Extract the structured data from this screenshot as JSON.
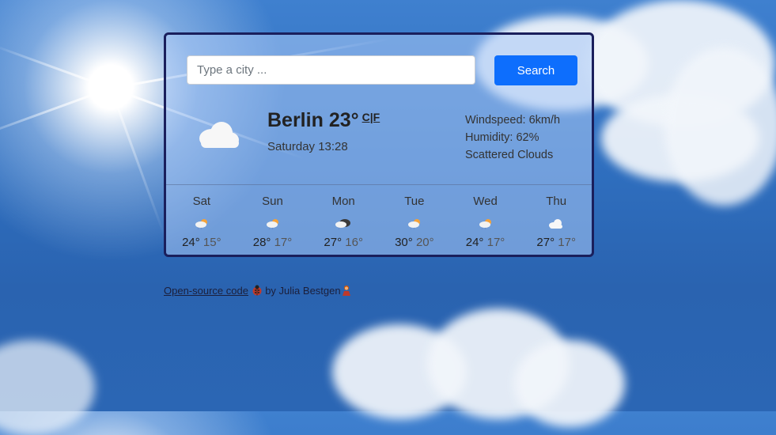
{
  "search": {
    "placeholder": "Type a city ...",
    "value": "",
    "button_label": "Search"
  },
  "current": {
    "city": "Berlin",
    "temperature": "23°",
    "unit_toggle": "C|F",
    "datetime": "Saturday 13:28",
    "icon": "cloud-icon",
    "details": [
      "Windspeed: 6km/h",
      "Humidity: 62%",
      "Scattered Clouds"
    ]
  },
  "forecast": [
    {
      "day": "Sat",
      "icon": "sun-rain-icon",
      "max": "24°",
      "min": "15°"
    },
    {
      "day": "Sun",
      "icon": "sun-rain-icon",
      "max": "28°",
      "min": "17°"
    },
    {
      "day": "Mon",
      "icon": "storm-cloud-icon",
      "max": "27°",
      "min": "16°"
    },
    {
      "day": "Tue",
      "icon": "sun-rain-icon",
      "max": "30°",
      "min": "20°"
    },
    {
      "day": "Wed",
      "icon": "sun-rain-icon",
      "max": "24°",
      "min": "17°"
    },
    {
      "day": "Thu",
      "icon": "cloud-icon",
      "max": "27°",
      "min": "17°"
    }
  ],
  "footer": {
    "link_text": "Open-source code",
    "by_text": "by Julia Bestgen"
  },
  "colors": {
    "accent": "#0d6efd",
    "card_border": "#1a1f5c"
  }
}
